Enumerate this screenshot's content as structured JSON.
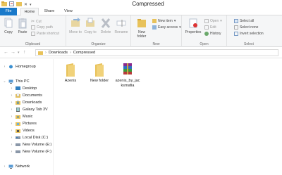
{
  "window": {
    "title": "Compressed"
  },
  "tabs": {
    "file": "File",
    "home": "Home",
    "share": "Share",
    "view": "View"
  },
  "ribbon": {
    "clipboard": {
      "label": "Clipboard",
      "copy": "Copy",
      "paste": "Paste",
      "cut": "Cut",
      "copy_path": "Copy path",
      "paste_shortcut": "Paste shortcut"
    },
    "organize": {
      "label": "Organize",
      "move_to": "Move to",
      "copy_to": "Copy to",
      "delete": "Delete",
      "rename": "Rename"
    },
    "new": {
      "label": "New",
      "new_folder": "New folder",
      "new_item": "New item",
      "easy_access": "Easy access"
    },
    "open": {
      "label": "Open",
      "properties": "Properties",
      "open": "Open",
      "edit": "Edit",
      "history": "History"
    },
    "select": {
      "label": "Select",
      "select_all": "Select all",
      "select_none": "Select none",
      "invert_selection": "Invert selection"
    }
  },
  "address": {
    "path": [
      "Downloads",
      "Compressed"
    ]
  },
  "nav": {
    "homegroup": "Homegroup",
    "this_pc": "This PC",
    "items": [
      "Desktop",
      "Documents",
      "Downloads",
      "Galaxy Tab 3V",
      "Music",
      "Pictures",
      "Videos",
      "Local Disk (C:)",
      "New Volume (E:)",
      "New Volume (F:)"
    ],
    "network": "Network"
  },
  "files": [
    {
      "name": "Azenis",
      "kind": "folder"
    },
    {
      "name": "New folder",
      "kind": "folder"
    },
    {
      "name": "azenis_by_jacksmafia",
      "kind": "archive"
    }
  ],
  "colors": {
    "file_tab": "#1979ca",
    "folder": "#e8c25a",
    "accent": "#1979ca"
  }
}
